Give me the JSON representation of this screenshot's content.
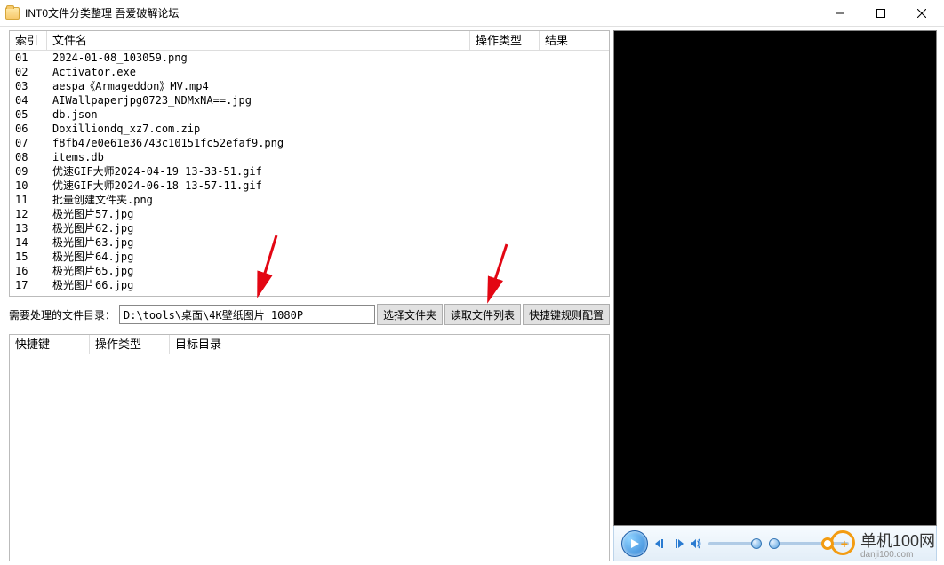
{
  "window": {
    "title": "INT0文件分类整理 吾爱破解论坛"
  },
  "toolbar": {
    "path_label": "需要处理的文件目录：",
    "path_value": "D:\\tools\\桌面\\4K壁纸图片 1080P",
    "choose_folder": "选择文件夹",
    "read_list": "读取文件列表",
    "hotkey_config": "快捷键规则配置"
  },
  "grid1": {
    "headers": {
      "idx": "索引",
      "name": "文件名",
      "op": "操作类型",
      "res": "结果"
    },
    "rows": [
      {
        "idx": "01",
        "name": "2024-01-08_103059.png"
      },
      {
        "idx": "02",
        "name": "Activator.exe"
      },
      {
        "idx": "03",
        "name": "aespa《Armageddon》MV.mp4"
      },
      {
        "idx": "04",
        "name": "AIWallpaperjpg0723_NDMxNA==.jpg"
      },
      {
        "idx": "05",
        "name": "db.json"
      },
      {
        "idx": "06",
        "name": "Doxilliondq_xz7.com.zip"
      },
      {
        "idx": "07",
        "name": "f8fb47e0e61e36743c10151fc52efaf9.png"
      },
      {
        "idx": "08",
        "name": "items.db"
      },
      {
        "idx": "09",
        "name": "优速GIF大师2024-04-19 13-33-51.gif"
      },
      {
        "idx": "10",
        "name": "优速GIF大师2024-06-18 13-57-11.gif"
      },
      {
        "idx": "11",
        "name": "批量创建文件夹.png"
      },
      {
        "idx": "12",
        "name": "极光图片57.jpg"
      },
      {
        "idx": "13",
        "name": "极光图片62.jpg"
      },
      {
        "idx": "14",
        "name": "极光图片63.jpg"
      },
      {
        "idx": "15",
        "name": "极光图片64.jpg"
      },
      {
        "idx": "16",
        "name": "极光图片65.jpg"
      },
      {
        "idx": "17",
        "name": "极光图片66.jpg"
      }
    ]
  },
  "grid2": {
    "headers": {
      "hk": "快捷键",
      "op": "操作类型",
      "target": "目标目录"
    }
  },
  "watermark": {
    "brand": "单机100网",
    "domain": "danji100.com"
  }
}
